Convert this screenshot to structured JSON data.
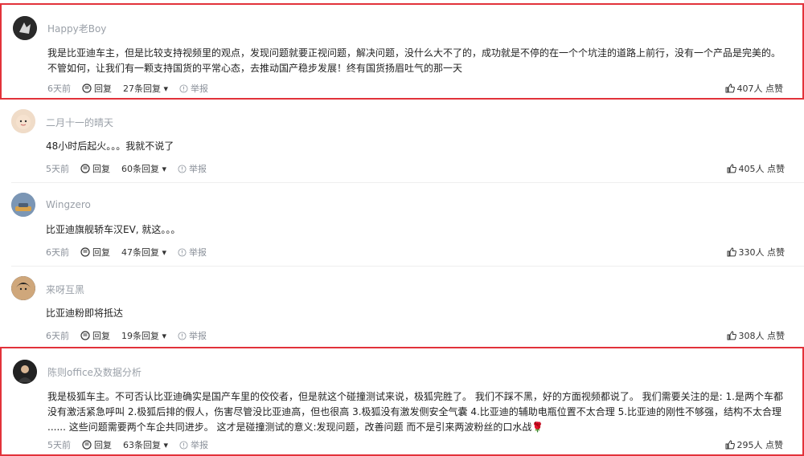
{
  "labels": {
    "reply": "回复",
    "report": "举报",
    "caret": "▾"
  },
  "comments": [
    {
      "user": "Happy老Boy",
      "lines": [
        "我是比亚迪车主，但是比较支持视频里的观点，发现问题就要正视问题，解决问题，没什么大不了的，成功就是不停的在一个个坑洼的道路上前行，没有一个产品是完美的。",
        "不管如何，让我们有一颗支持国货的平常心态，去推动国产稳步发展！终有国货扬眉吐气的那一天"
      ],
      "time": "6天前",
      "replies": "27条回复",
      "likes": "407人 点赞",
      "highlighted": true
    },
    {
      "user": "二月十一的晴天",
      "lines": [
        "48小时后起火。。。我就不说了"
      ],
      "time": "5天前",
      "replies": "60条回复",
      "likes": "405人 点赞",
      "highlighted": false
    },
    {
      "user": "Wingzero",
      "lines": [
        "比亚迪旗舰轿车汉EV, 就这。。。"
      ],
      "time": "6天前",
      "replies": "47条回复",
      "likes": "330人 点赞",
      "highlighted": false
    },
    {
      "user": "来呀互黑",
      "lines": [
        "比亚迪粉即将抵达"
      ],
      "time": "6天前",
      "replies": "19条回复",
      "likes": "308人 点赞",
      "highlighted": false
    },
    {
      "user": "陈则office及数据分析",
      "lines": [
        "我是极狐车主。不可否认比亚迪确实是国产车里的佼佼者，但是就这个碰撞测试来说，极狐完胜了。 我们不踩不黑，好的方面视频都说了。 我们需要关注的是: 1.是两个车都",
        "没有激活紧急呼叫 2.极狐后排的假人，伤害尽管没比亚迪高，但也很高 3.极狐没有激发侧安全气囊 4.比亚迪的辅助电瓶位置不太合理 5.比亚迪的刚性不够强，结构不太合理",
        "...... 这些问题需要两个车企共同进步。 这才是碰撞测试的意义:发现问题，改善问题 而不是引来两波粉丝的口水战🌹"
      ],
      "time": "5天前",
      "replies": "63条回复",
      "likes": "295人 点赞",
      "highlighted": true
    }
  ]
}
